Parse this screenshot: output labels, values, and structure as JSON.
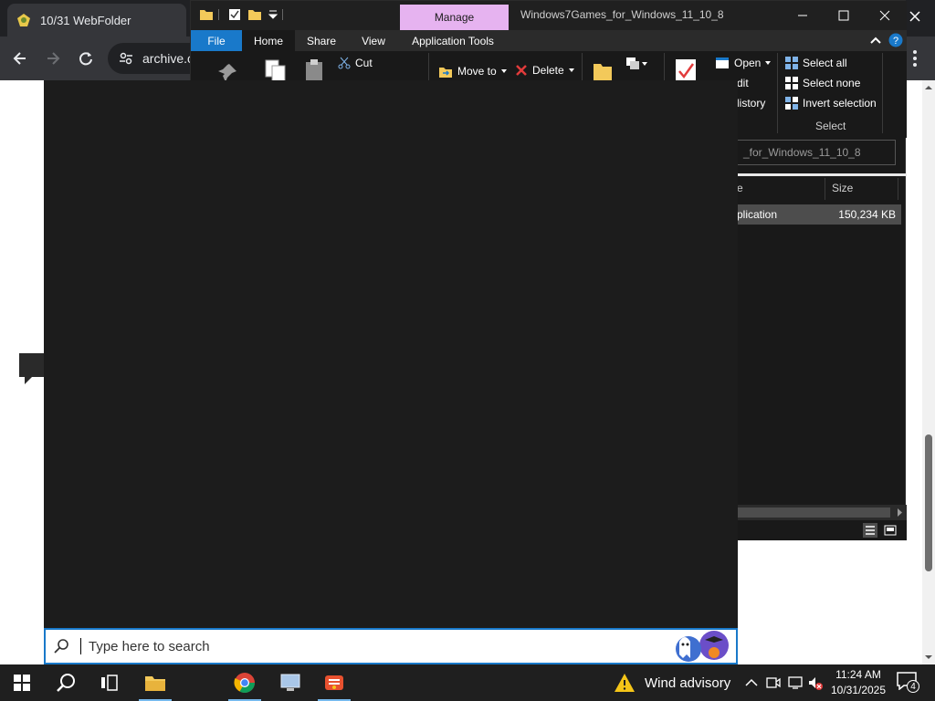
{
  "browser": {
    "tab_title": "10/31 WebFolder",
    "url": "archive.o"
  },
  "explorer": {
    "manage_label": "Manage",
    "title": "Windows7Games_for_Windows_11_10_8",
    "tabs": [
      "File",
      "Home",
      "Share",
      "View",
      "Application Tools"
    ],
    "ribbon": {
      "cut": "Cut",
      "move_to": "Move to",
      "delete": "Delete",
      "open": "Open",
      "edit": "dit",
      "history": "listory",
      "select_all": "Select all",
      "select_none": "Select none",
      "invert_selection": "Invert selection",
      "select_group": "Select"
    },
    "address": "_for_Windows_11_10_8",
    "columns": {
      "type": "e",
      "size": "Size"
    },
    "file": {
      "type": "plication",
      "size": "150,234 KB"
    }
  },
  "search": {
    "placeholder": "Type here to search"
  },
  "taskbar": {
    "weather": "Wind advisory",
    "time": "11:24 AM",
    "date": "10/31/2025",
    "notifications": "4"
  },
  "colors": {
    "accent": "#1979ca",
    "manage_tab": "#e6b3f0",
    "weather_icon": "#f5c518"
  }
}
